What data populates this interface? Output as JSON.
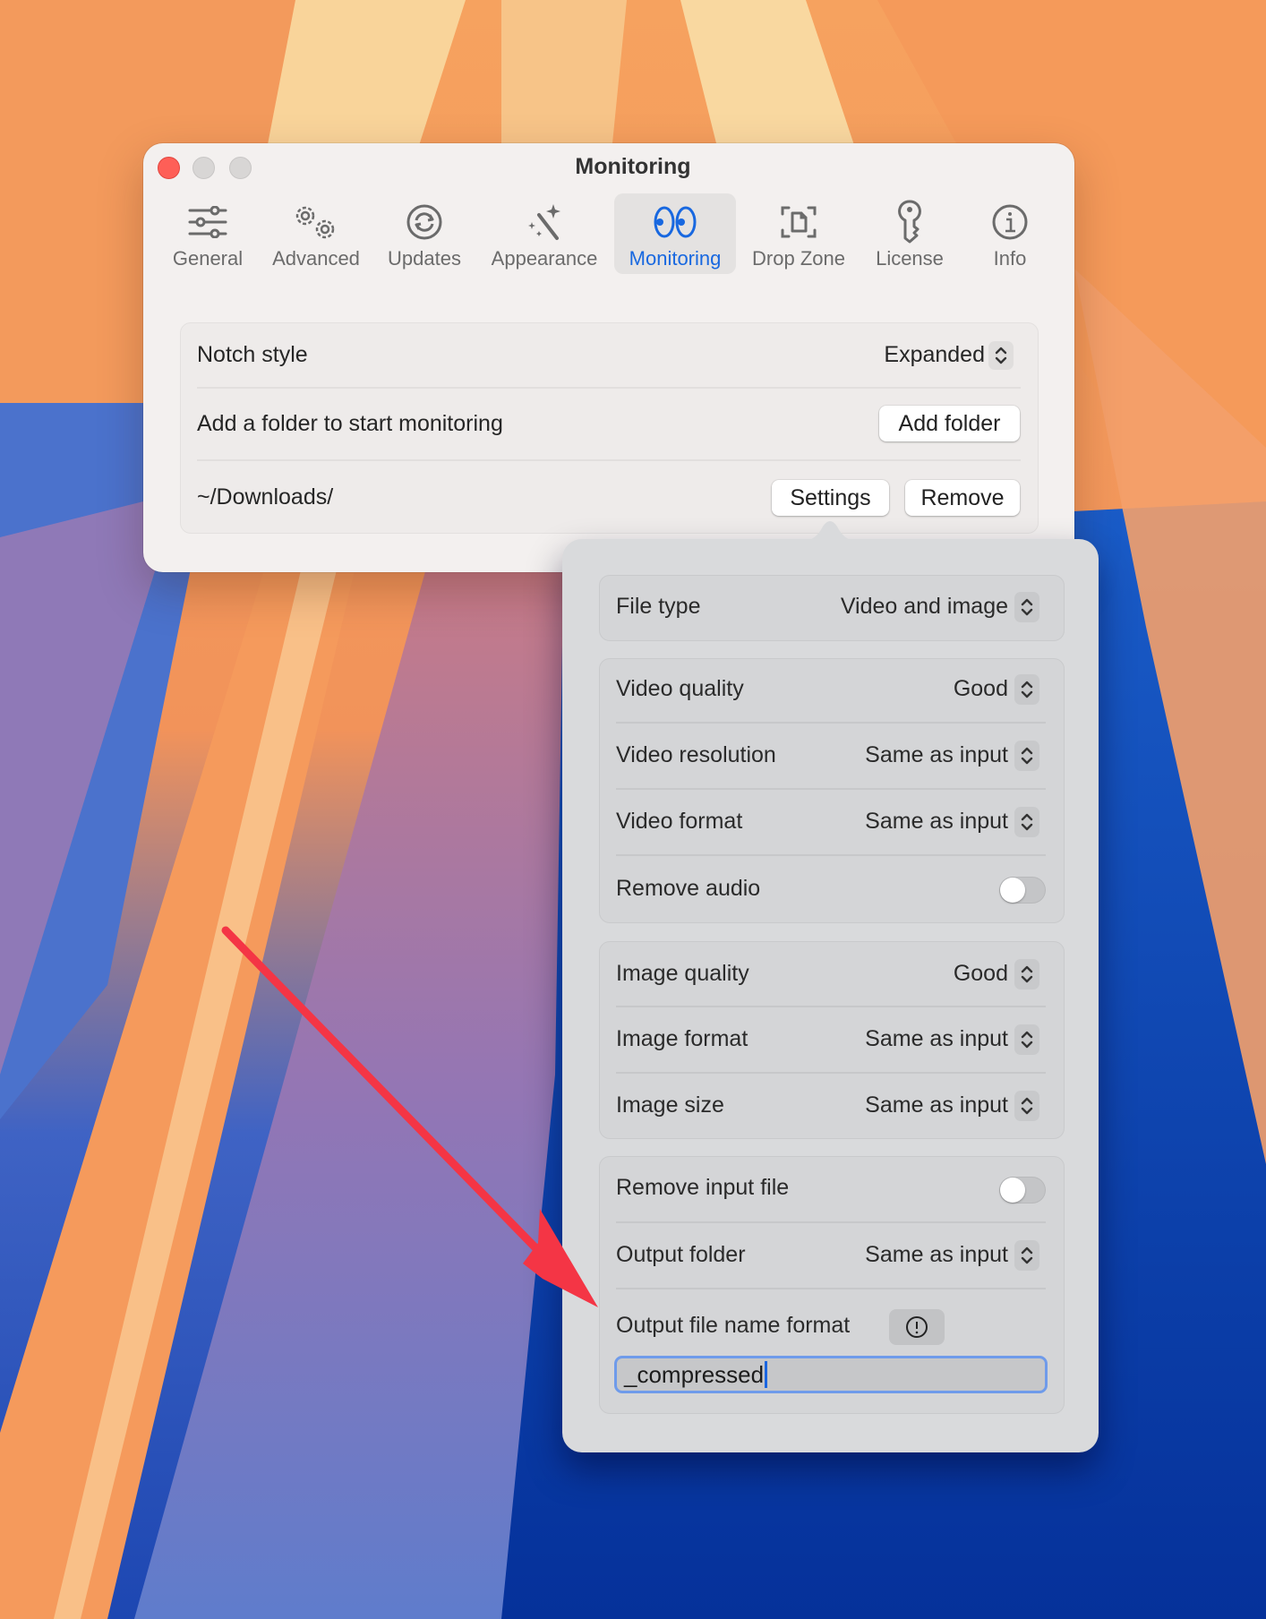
{
  "window": {
    "title": "Monitoring",
    "traffic_lights": [
      "close",
      "minimize",
      "zoom"
    ]
  },
  "toolbar": {
    "tabs": [
      {
        "label": "General",
        "icon": "sliders-icon",
        "active": false
      },
      {
        "label": "Advanced",
        "icon": "gears-icon",
        "active": false
      },
      {
        "label": "Updates",
        "icon": "refresh-icon",
        "active": false
      },
      {
        "label": "Appearance",
        "icon": "magic-wand-icon",
        "active": false
      },
      {
        "label": "Monitoring",
        "icon": "eyes-icon",
        "active": true
      },
      {
        "label": "Drop Zone",
        "icon": "document-viewfinder-icon",
        "active": false
      },
      {
        "label": "License",
        "icon": "key-icon",
        "active": false
      },
      {
        "label": "Info",
        "icon": "info-icon",
        "active": false
      }
    ],
    "accent_color": "#1868e0"
  },
  "main": {
    "notch_style": {
      "label": "Notch style",
      "value": "Expanded"
    },
    "add_folder": {
      "label": "Add a folder to start monitoring",
      "button": "Add folder"
    },
    "folders": [
      {
        "path": "~/Downloads/",
        "settings_button": "Settings",
        "remove_button": "Remove"
      }
    ]
  },
  "popover": {
    "file_type": {
      "label": "File type",
      "value": "Video and image"
    },
    "video": [
      {
        "label": "Video quality",
        "value": "Good"
      },
      {
        "label": "Video resolution",
        "value": "Same as input"
      },
      {
        "label": "Video format",
        "value": "Same as input"
      },
      {
        "label": "Remove audio",
        "toggle": false
      }
    ],
    "image": [
      {
        "label": "Image quality",
        "value": "Good"
      },
      {
        "label": "Image format",
        "value": "Same as input"
      },
      {
        "label": "Image size",
        "value": "Same as input"
      }
    ],
    "output": {
      "remove_input_file": {
        "label": "Remove input file",
        "toggle": false
      },
      "output_folder": {
        "label": "Output folder",
        "value": "Same as input"
      },
      "file_name_format": {
        "label": "Output file name format",
        "value": "_compressed"
      }
    }
  },
  "annotation": {
    "type": "arrow",
    "color": "#f43545"
  }
}
